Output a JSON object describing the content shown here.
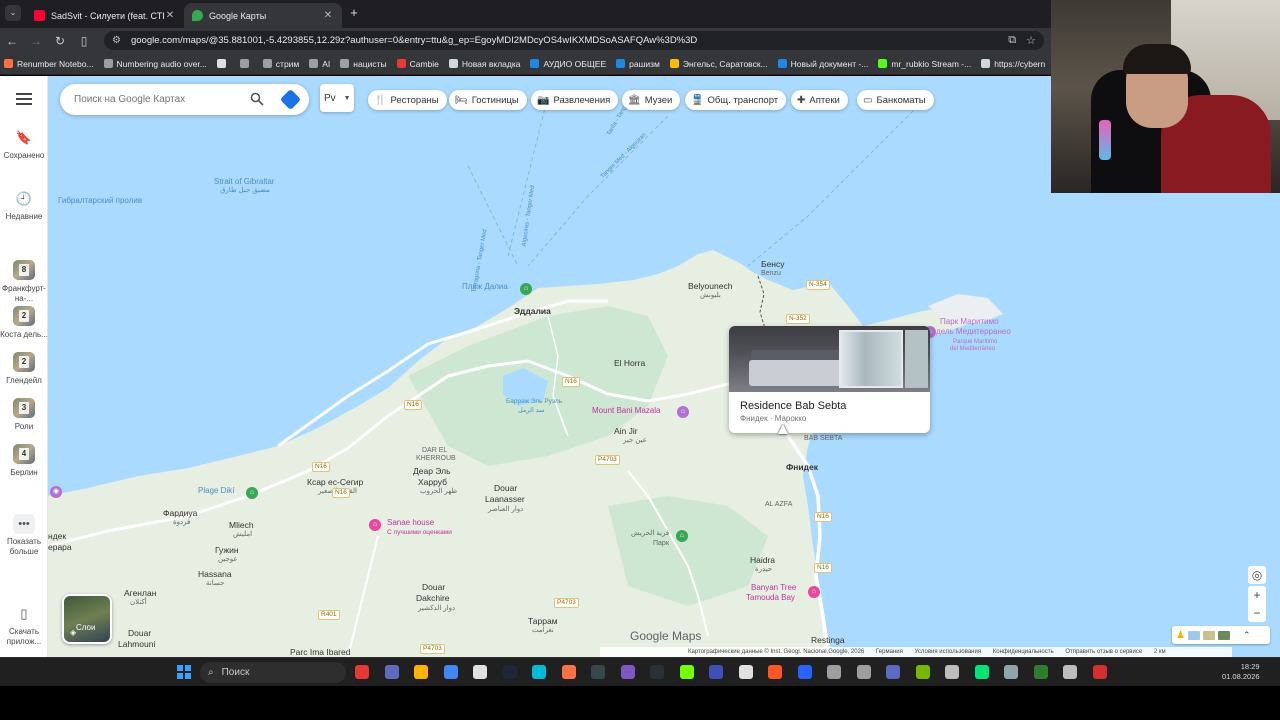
{
  "browser": {
    "tabs": [
      {
        "title": "SadSvit - Силуети (feat. СТРУКТ",
        "icon_color": "#ff0033",
        "active": false
      },
      {
        "title": "Google Карты",
        "icon_color": "#34a853",
        "active": true
      }
    ],
    "url": "google.com/maps/@35.881001,-5.4293855,12.29z?authuser=0&entry=ttu&g_ep=EgoyMDI2MDcyOS4wIKXMDSoASAFQAw%3D%3D",
    "bookmarks": [
      {
        "label": "Renumber Notebo...",
        "color": "#ff7043"
      },
      {
        "label": "Numbering audio over...",
        "color": "#9e9e9e"
      },
      {
        "label": "",
        "color": "#e0e0e0"
      },
      {
        "label": "",
        "color": "#9e9e9e"
      },
      {
        "label": "стрим",
        "color": "#9aa0a6"
      },
      {
        "label": "AI",
        "color": "#9aa0a6"
      },
      {
        "label": "нацисты",
        "color": "#9aa0a6"
      },
      {
        "label": "Cambie",
        "color": "#e53935"
      },
      {
        "label": "Новая вкладка",
        "color": "#cfd8dc"
      },
      {
        "label": "АУДИО ОБЩЕЕ",
        "color": "#1e88e5"
      },
      {
        "label": "рашизм",
        "color": "#1e88e5"
      },
      {
        "label": "Энгельс, Саратовск...",
        "color": "#fbbc04"
      },
      {
        "label": "Новый документ -...",
        "color": "#1e88e5"
      },
      {
        "label": "mr_rubkio Stream -...",
        "color": "#53fc18"
      },
      {
        "label": "https://cybern",
        "color": "#cfd8dc"
      }
    ]
  },
  "maps": {
    "search_placeholder": "Поиск на Google Картах",
    "language": "Рv",
    "chips": [
      {
        "label": "Рестораны",
        "icon": "fork-knife-icon",
        "glyph": "🍴"
      },
      {
        "label": "Гостиницы",
        "icon": "bed-icon",
        "glyph": "🛏"
      },
      {
        "label": "Развлечения",
        "icon": "camera-icon",
        "glyph": "📷"
      },
      {
        "label": "Музеи",
        "icon": "museum-icon",
        "glyph": "🏛"
      },
      {
        "label": "Общ. транспорт",
        "icon": "transit-icon",
        "glyph": "🚆"
      },
      {
        "label": "Аптеки",
        "icon": "pharmacy-icon",
        "glyph": "✚"
      },
      {
        "label": "Банкоматы",
        "icon": "atm-icon",
        "glyph": "▭"
      }
    ],
    "rail": {
      "saved": "Сохранено",
      "recent": "Недавние",
      "recents": [
        {
          "label": "Франкфурт-на-...",
          "num": "8"
        },
        {
          "label": "Коста дель...",
          "num": "2"
        },
        {
          "label": "Глендейл",
          "num": "2"
        },
        {
          "label": "Роли",
          "num": "3"
        },
        {
          "label": "Берлин",
          "num": "4"
        }
      ],
      "more": "Показать больше",
      "download": "Скачать прилож..."
    },
    "labels": {
      "strait_en": "Strait of Gibraltar",
      "strait_ar": "مضيق جبل طارق",
      "strait_ru": "Гибралтарский пролив",
      "beach_dalia": "Пляж Далиа",
      "eddalia": "Эддалиа",
      "bensu": "Бенсу",
      "benzu": "Benzu",
      "belyounech": "Belyounech",
      "belyounech_ar": "بليونش",
      "el_horra": "El Horra",
      "dam": "Барраж Эль Руэль",
      "dam_ar": "سد الرمل",
      "mount": "Mount Bani Mazala",
      "ain_jir": "Ain Jir",
      "ain_jir_ar": "عين جير",
      "dar_el": "DAR EL",
      "kherroub": "KHERROUB",
      "dear_el": "Деар Эль",
      "harroub": "Харруб",
      "harroub_ar": "ظهر الحروب",
      "ksar": "Ксар ес-Сегир",
      "ksar_ar": "القصر الصغير",
      "douar": "Douar",
      "laanasser": "Laanasser",
      "laanasser_ar": "دوار العناصر",
      "plage": "Plage Dikí",
      "fardiua": "Фардиуа",
      "fardiua_ar": "فردوة",
      "mliech": "Mliech",
      "mliech_ar": "امليش",
      "gujin": "Гужин",
      "gujin_ar": "عوجين",
      "hassana": "Hassana",
      "hassana_ar": "حسانة",
      "sanae": "Sanae house",
      "sanae_sub": "С лучшими оценками",
      "park": "قرية الحريش",
      "park_ru": "Парк",
      "fnideq": "Фнидек",
      "al_azfa": "AL AZFA",
      "bab_sebta": "BAB SEBTA",
      "haidra": "Haidra",
      "haidra_ar": "حيدرة",
      "banyan": "Banyan Tree",
      "tamouda": "Tamouda Bay",
      "agenlan": "Агенлан",
      "agenlan_ar": "أكنلان",
      "douar_dakchire": "Douar",
      "dakchire": "Dakchire",
      "dakchire_ar": "دوار الدكشير",
      "tarram": "Таррам",
      "tarram_ar": "تغرامت",
      "restinga": "Restinga",
      "lahmouni_1": "Douar",
      "lahmouni_2": "Lahmouni",
      "parc": "Parc Ima Ibared",
      "marina": "Парк Маритимо",
      "marina2": "дель Медитерранео",
      "marina_sub": "Parque Marítimo",
      "marina_sub2": "del Mediterráneo",
      "tiendek": "ндек",
      "tierapa": "ерара",
      "roads": [
        "N-354",
        "N-352",
        "N16",
        "N16",
        "N16",
        "N16",
        "P4703",
        "P4703",
        "R401",
        "P4703",
        "N16",
        "N16"
      ],
      "ships": [
        "Tarifa - Tanger Med",
        "Algeciras - Tanger Med",
        "Tanger Med - Algeciras",
        "Tarragona - Tanger Med"
      ]
    },
    "card": {
      "name": "Residence Bab Sebta",
      "location": "Фнидек · Марокко"
    },
    "layers_label": "Слои",
    "brand": "Google Maps",
    "footer": [
      "Картографические данные © Inst. Geogr. Nacional,Google, 2026",
      "Германия",
      "Условия использования",
      "Конфиденциальность",
      "Отправить отзыв о сервисе",
      "2 км"
    ]
  },
  "taskbar": {
    "search": "Поиск",
    "time": "18:29",
    "date": "01.08.2026",
    "icons": [
      "#e53935",
      "#5c6bc0",
      "#ffb300",
      "#4285f4",
      "#e0e0e0",
      "#1b2838",
      "#00bcd4",
      "#ff7043",
      "#37474f",
      "#7e57c2",
      "#263238",
      "#76ff03",
      "#3f51b5",
      "#e0e0e0",
      "#ff5722",
      "#2962ff",
      "#9e9e9e",
      "#9e9e9e",
      "#5c6bc0",
      "#76b900",
      "#bdbdbd",
      "#00e676",
      "#90a4ae",
      "#2e7d32",
      "#bdbdbd",
      "#d32f2f"
    ]
  }
}
